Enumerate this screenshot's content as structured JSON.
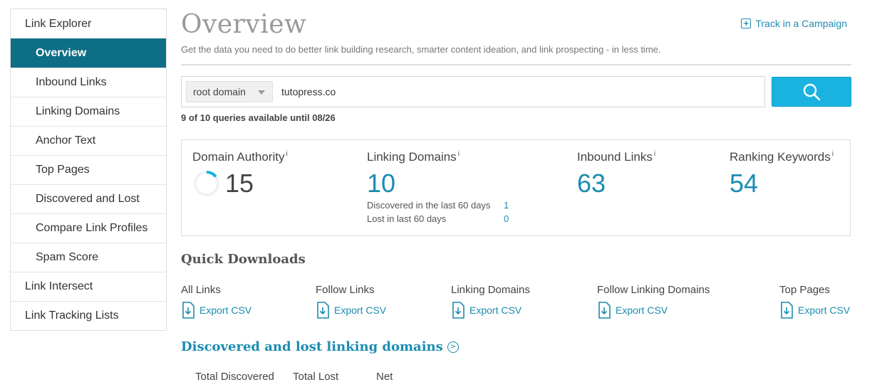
{
  "sidebar": {
    "items": [
      {
        "label": "Link Explorer",
        "level": "top",
        "active": false
      },
      {
        "label": "Overview",
        "level": "sub",
        "active": true
      },
      {
        "label": "Inbound Links",
        "level": "sub",
        "active": false
      },
      {
        "label": "Linking Domains",
        "level": "sub",
        "active": false
      },
      {
        "label": "Anchor Text",
        "level": "sub",
        "active": false
      },
      {
        "label": "Top Pages",
        "level": "sub",
        "active": false
      },
      {
        "label": "Discovered and Lost",
        "level": "sub",
        "active": false
      },
      {
        "label": "Compare Link Profiles",
        "level": "sub",
        "active": false
      },
      {
        "label": "Spam Score",
        "level": "sub",
        "active": false
      },
      {
        "label": "Link Intersect",
        "level": "top",
        "active": false
      },
      {
        "label": "Link Tracking Lists",
        "level": "top",
        "active": false
      }
    ]
  },
  "header": {
    "title": "Overview",
    "track_label": "Track in a Campaign",
    "subtitle": "Get the data you need to do better link building research, smarter content ideation, and link prospecting - in less time."
  },
  "search": {
    "scope": "root domain",
    "value": "tutopress.co",
    "queries_text": "9 of 10 queries available until 08/26"
  },
  "metrics": {
    "info_glyph": "i",
    "domain_authority": {
      "label": "Domain Authority",
      "value": "15",
      "fraction": 0.15
    },
    "linking_domains": {
      "label": "Linking Domains",
      "value": "10",
      "discovered_label": "Discovered in the last 60 days",
      "discovered_value": "1",
      "lost_label": "Lost in last 60 days",
      "lost_value": "0"
    },
    "inbound_links": {
      "label": "Inbound Links",
      "value": "63"
    },
    "ranking_keywords": {
      "label": "Ranking Keywords",
      "value": "54"
    }
  },
  "quick_downloads": {
    "title": "Quick Downloads",
    "export_label": "Export CSV",
    "items": [
      "All Links",
      "Follow Links",
      "Linking Domains",
      "Follow Linking Domains",
      "Top Pages"
    ]
  },
  "discovered_lost": {
    "title": "Discovered and lost linking domains",
    "columns": [
      "Total Discovered",
      "Total Lost",
      "Net"
    ]
  },
  "colors": {
    "accent": "#1a8cb0",
    "active_nav": "#0e6e85",
    "search_button": "#1ab3e0"
  },
  "icons": {
    "track": "plus-box-icon",
    "search": "magnifier-icon",
    "export": "download-file-icon",
    "section_more": "circle-chevron-right-icon"
  }
}
